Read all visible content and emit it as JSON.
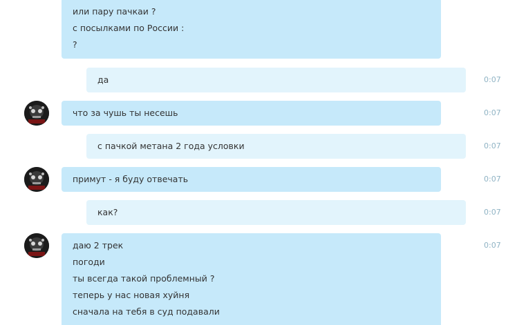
{
  "messages": [
    {
      "id": 1,
      "dir": "in",
      "time": "",
      "lines": [
        "или пару пачкаи ?",
        "с посылками по России :",
        "?"
      ]
    },
    {
      "id": 2,
      "dir": "out",
      "time": "0:07",
      "lines": [
        "да"
      ]
    },
    {
      "id": 3,
      "dir": "in",
      "time": "0:07",
      "lines": [
        "что за чушь ты несешь"
      ]
    },
    {
      "id": 4,
      "dir": "out",
      "time": "0:07",
      "lines": [
        "с пачкой метана 2 года условки"
      ]
    },
    {
      "id": 5,
      "dir": "in",
      "time": "0:07",
      "lines": [
        "примут - я буду отвечать"
      ]
    },
    {
      "id": 6,
      "dir": "out",
      "time": "0:07",
      "lines": [
        "как?"
      ]
    },
    {
      "id": 7,
      "dir": "in",
      "time": "0:07",
      "lines": [
        "даю 2 трек",
        "погоди",
        "ты всегда такой проблемный ?",
        "теперь у нас новая хуйня",
        "сначала на тебя в суд подавали"
      ]
    }
  ],
  "avatar": {
    "icon": "user-avatar-icon"
  },
  "colors": {
    "incoming": "#c6e9fa",
    "outgoing": "#e2f4fc",
    "timestamp": "#8fb3c4"
  }
}
